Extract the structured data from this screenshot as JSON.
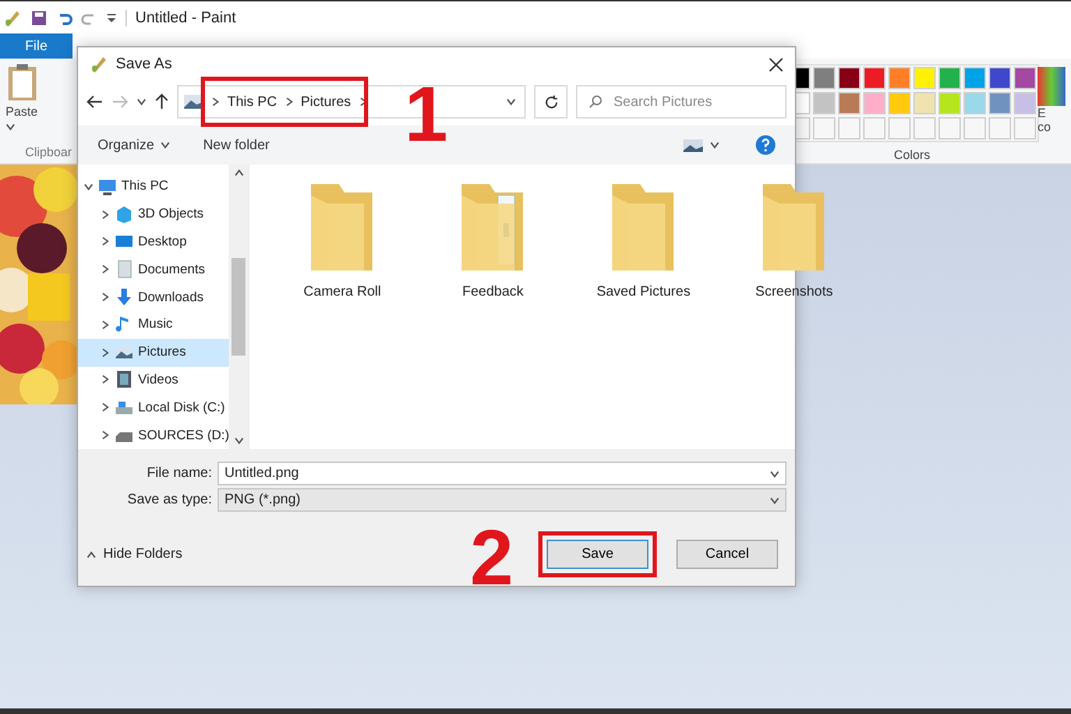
{
  "paint": {
    "title": "Untitled - Paint",
    "file_tab": "File",
    "paste_label": "Paste",
    "clipboard_label": "Clipboar",
    "colors_label": "Colors",
    "edit_colors": [
      "E",
      "co"
    ],
    "palette": [
      [
        {
          "color": "#000000"
        },
        {
          "color": "#7f7f7f"
        },
        {
          "color": "#880015"
        },
        {
          "color": "#ed1c24"
        },
        {
          "color": "#ff7f27"
        },
        {
          "color": "#fff200"
        },
        {
          "color": "#22b14c"
        },
        {
          "color": "#00a2e8"
        },
        {
          "color": "#3f48cc"
        },
        {
          "color": "#a349a4"
        }
      ],
      [
        {
          "color": "#ffffff"
        },
        {
          "color": "#c3c3c3"
        },
        {
          "color": "#b97a57"
        },
        {
          "color": "#ffaec9"
        },
        {
          "color": "#ffc90e"
        },
        {
          "color": "#efe4b0"
        },
        {
          "color": "#b5e61d"
        },
        {
          "color": "#99d9ea"
        },
        {
          "color": "#7092be"
        },
        {
          "color": "#c8bfe7"
        }
      ]
    ]
  },
  "dialog": {
    "title": "Save As",
    "address": {
      "crumbs": [
        "This PC",
        "Pictures"
      ],
      "annotation": "1"
    },
    "search": {
      "placeholder": "Search Pictures"
    },
    "toolbar": {
      "organize": "Organize",
      "new_folder": "New folder"
    },
    "tree": [
      {
        "label": "This PC",
        "kind": "pc",
        "expanded": true,
        "selected": false,
        "children": [
          {
            "label": "3D Objects",
            "kind": "objects",
            "expanded": false,
            "selected": false
          },
          {
            "label": "Desktop",
            "kind": "desktop",
            "expanded": false,
            "selected": false
          },
          {
            "label": "Documents",
            "kind": "documents",
            "expanded": false,
            "selected": false
          },
          {
            "label": "Downloads",
            "kind": "downloads",
            "expanded": false,
            "selected": false
          },
          {
            "label": "Music",
            "kind": "music",
            "expanded": false,
            "selected": false
          },
          {
            "label": "Pictures",
            "kind": "pictures",
            "expanded": false,
            "selected": true
          },
          {
            "label": "Videos",
            "kind": "videos",
            "expanded": false,
            "selected": false
          },
          {
            "label": "Local Disk (C:)",
            "kind": "disk",
            "expanded": false,
            "selected": false
          },
          {
            "label": "SOURCES (D:)",
            "kind": "drive",
            "expanded": false,
            "selected": false
          }
        ]
      }
    ],
    "folders": [
      {
        "label": "Camera Roll",
        "kind": "plain"
      },
      {
        "label": "Feedback",
        "kind": "documents"
      },
      {
        "label": "Saved Pictures",
        "kind": "plain"
      },
      {
        "label": "Screenshots",
        "kind": "plain"
      }
    ],
    "file_name": {
      "label": "File name:",
      "value": "Untitled.png"
    },
    "save_type": {
      "label": "Save as type:",
      "value": "PNG (*.png)"
    },
    "hide_folders": "Hide Folders",
    "buttons": [
      {
        "label": "Save",
        "kind": "primary",
        "annotation": "2"
      },
      {
        "label": "Cancel",
        "kind": "secondary"
      }
    ]
  }
}
